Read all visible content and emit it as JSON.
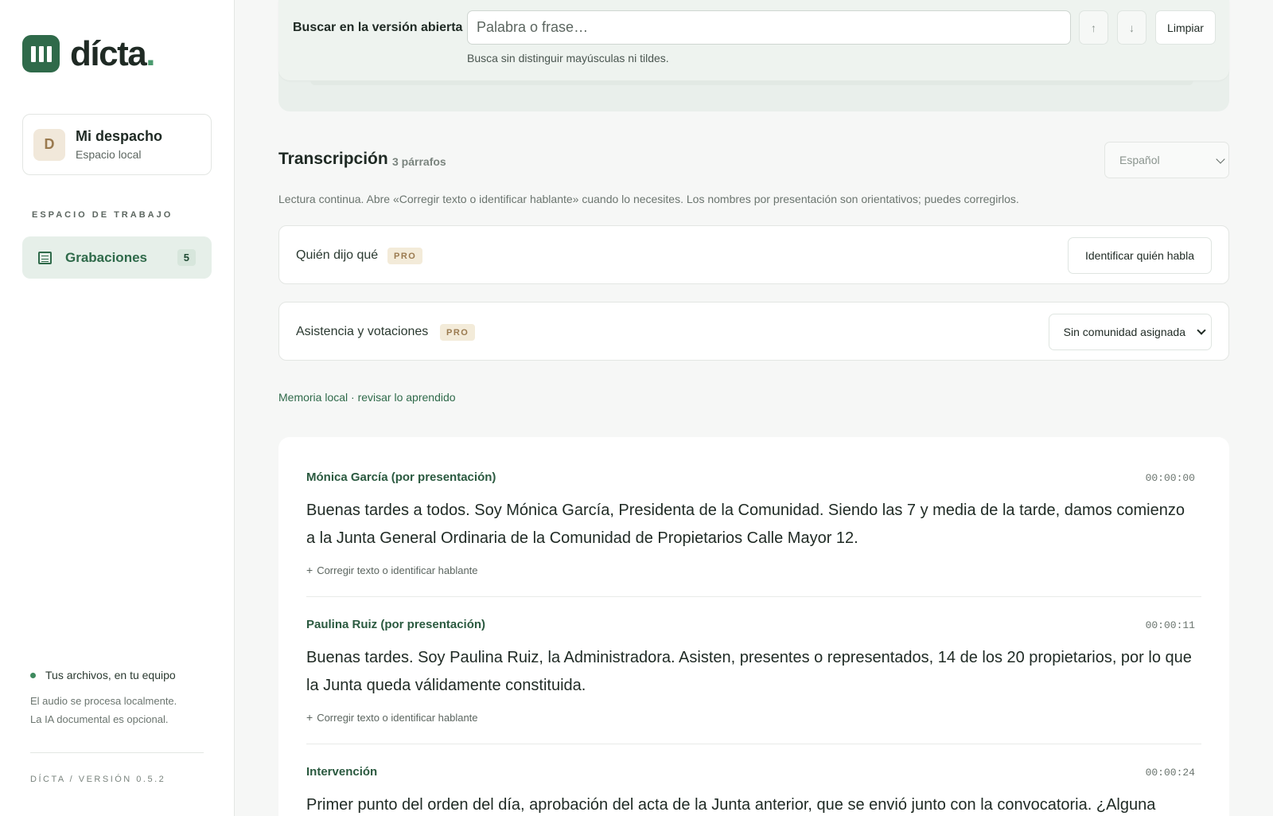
{
  "brand": {
    "name": "dícta",
    "dot": "."
  },
  "workspace": {
    "initial": "D",
    "name": "Mi despacho",
    "subtitle": "Espacio local"
  },
  "sidebar": {
    "section_label": "ESPACIO DE TRABAJO",
    "items": [
      {
        "label": "Grabaciones",
        "count": "5"
      }
    ]
  },
  "privacy": {
    "title": "Tus archivos, en tu equipo",
    "line1": "El audio se procesa localmente.",
    "line2": "La IA documental es opcional."
  },
  "version": "DÍCTA / VERSIÓN 0.5.2",
  "search": {
    "label": "Buscar en la versión abierta",
    "placeholder": "Palabra o frase…",
    "value": "",
    "prev": "↑",
    "next": "↓",
    "clear_label": "Limpiar",
    "hint": "Busca sin distinguir mayúsculas ni tildes."
  },
  "transcript": {
    "title": "Transcripción",
    "count": "3 párrafos",
    "language": "Español",
    "note": "Lectura continua. Abre «Corregir texto o identificar hablante» cuando lo necesites. Los nombres por presentación son orientativos; puedes corregirlos."
  },
  "pro_features": {
    "speakers": {
      "label": "Quién dijo qué",
      "badge": "PRO",
      "action": "Identificar quién habla"
    },
    "attendance": {
      "label": "Asistencia y votaciones",
      "badge": "PRO",
      "select_value": "Sin comunidad asignada"
    }
  },
  "memory_link": "Memoria local · revisar lo aprendido",
  "paragraphs": [
    {
      "speaker": "Mónica García (por presentación)",
      "time": "00:00:00",
      "text": "Buenas tardes a todos. Soy Mónica García, Presidenta de la Comunidad. Siendo las 7 y media de la tarde, damos comienzo a la Junta General Ordinaria de la Comunidad de Propietarios Calle Mayor 12.",
      "edit": "Corregir texto o identificar hablante"
    },
    {
      "speaker": "Paulina Ruiz (por presentación)",
      "time": "00:00:11",
      "text": "Buenas tardes. Soy Paulina Ruiz, la Administradora. Asisten, presentes o representados, 14 de los 20 propietarios, por lo que la Junta queda válidamente constituida.",
      "edit": "Corregir texto o identificar hablante"
    },
    {
      "speaker": "Intervención",
      "time": "00:00:24",
      "text": "Primer punto del orden del día, aprobación del acta de la Junta anterior, que se envió junto con la convocatoria. ¿Alguna",
      "edit": ""
    }
  ]
}
